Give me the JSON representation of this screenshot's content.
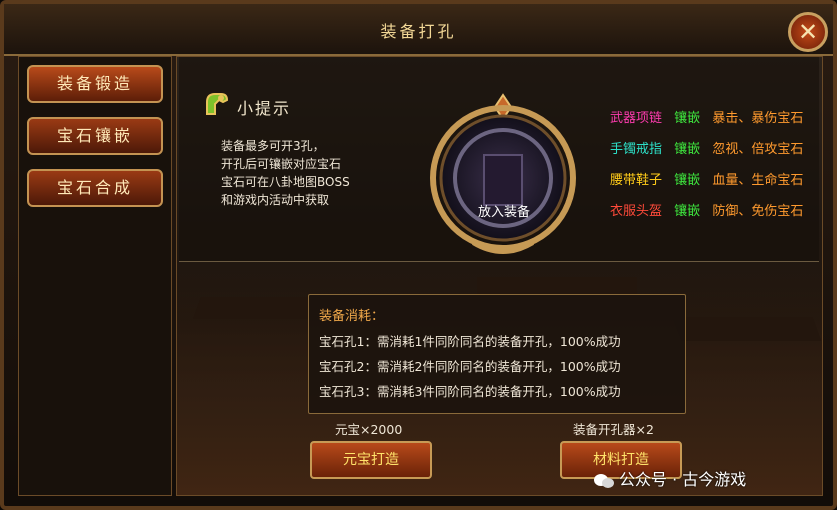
{
  "window": {
    "title": "装备打孔",
    "close_glyph": "✕"
  },
  "sidebar": {
    "items": [
      {
        "label": "装备锻造"
      },
      {
        "label": "宝石镶嵌"
      },
      {
        "label": "宝石合成"
      }
    ]
  },
  "tip": {
    "title": "小提示",
    "icon": "armor-arm-icon",
    "lines": [
      "装备最多可开3孔，",
      "开孔后可镶嵌对应宝石",
      "宝石可在八卦地图BOSS",
      "和游戏内活动中获取"
    ]
  },
  "slot": {
    "label": "放入装备"
  },
  "gem_rules": [
    {
      "slot": "武器项链",
      "slot_color": "#ff3cb0",
      "verb": "镶嵌",
      "gems": "暴击、暴伤宝石"
    },
    {
      "slot": "手镯戒指",
      "slot_color": "#2de0c8",
      "verb": "镶嵌",
      "gems": "忽视、倍攻宝石"
    },
    {
      "slot": "腰带鞋子",
      "slot_color": "#ffcc1a",
      "verb": "镶嵌",
      "gems": "血量、生命宝石"
    },
    {
      "slot": "衣服头盔",
      "slot_color": "#ff4a3a",
      "verb": "镶嵌",
      "gems": "防御、免伤宝石"
    }
  ],
  "colors": {
    "verb": "#3ee83e",
    "gems": "#ff9a2e",
    "button_text": "#ffe36a"
  },
  "cost": {
    "title": "装备消耗：",
    "lines": [
      "宝石孔1：需消耗1件同阶同名的装备开孔，100%成功",
      "宝石孔2：需消耗2件同阶同名的装备开孔，100%成功",
      "宝石孔3：需消耗3件同阶同名的装备开孔，100%成功"
    ]
  },
  "actions": {
    "gold_price": "元宝×2000",
    "gold_button": "元宝打造",
    "material_price": "装备开孔器×2",
    "material_button": "材料打造"
  },
  "watermark": {
    "text": "公众号 · 古今游戏"
  }
}
